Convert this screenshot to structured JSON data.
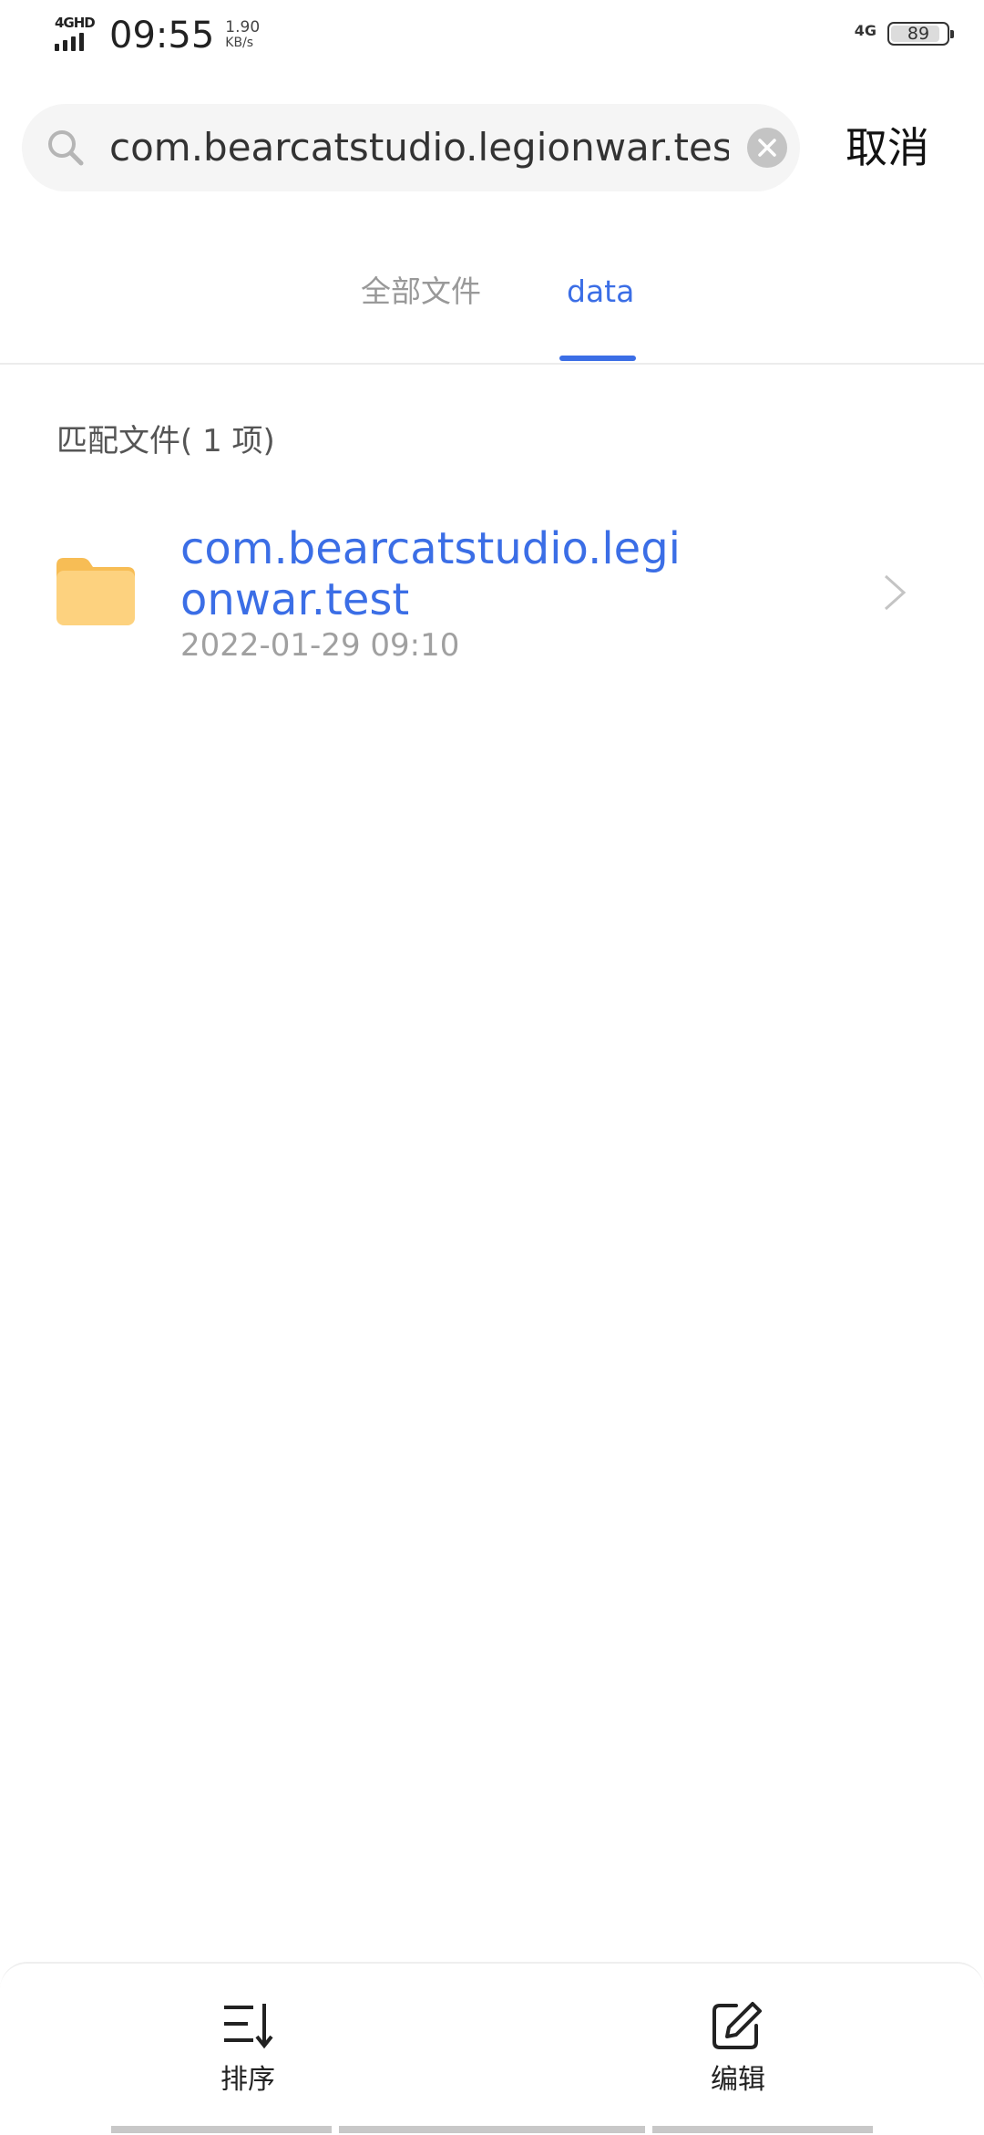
{
  "status_bar": {
    "network_type": "4GHD",
    "time": "09:55",
    "speed_value": "1.90",
    "speed_unit": "KB/s",
    "secondary_network": "4G",
    "battery": "89",
    "battery_level_percent": 89
  },
  "search": {
    "query": "com.bearcatstudio.legionwar.test",
    "cancel_label": "取消"
  },
  "tabs": [
    {
      "label": "全部文件",
      "active": false
    },
    {
      "label": "data",
      "active": true
    }
  ],
  "match_label": "匹配文件( 1 项)",
  "results": [
    {
      "name": "com.bearcatstudio.legionwar.test",
      "date": "2022-01-29 09:10",
      "icon": "folder-icon"
    }
  ],
  "bottom_bar": {
    "sort_label": "排序",
    "edit_label": "编辑"
  },
  "colors": {
    "accent": "#3b6ee6",
    "folder": "#fdd27f",
    "folder_tab": "#f7bd55"
  }
}
